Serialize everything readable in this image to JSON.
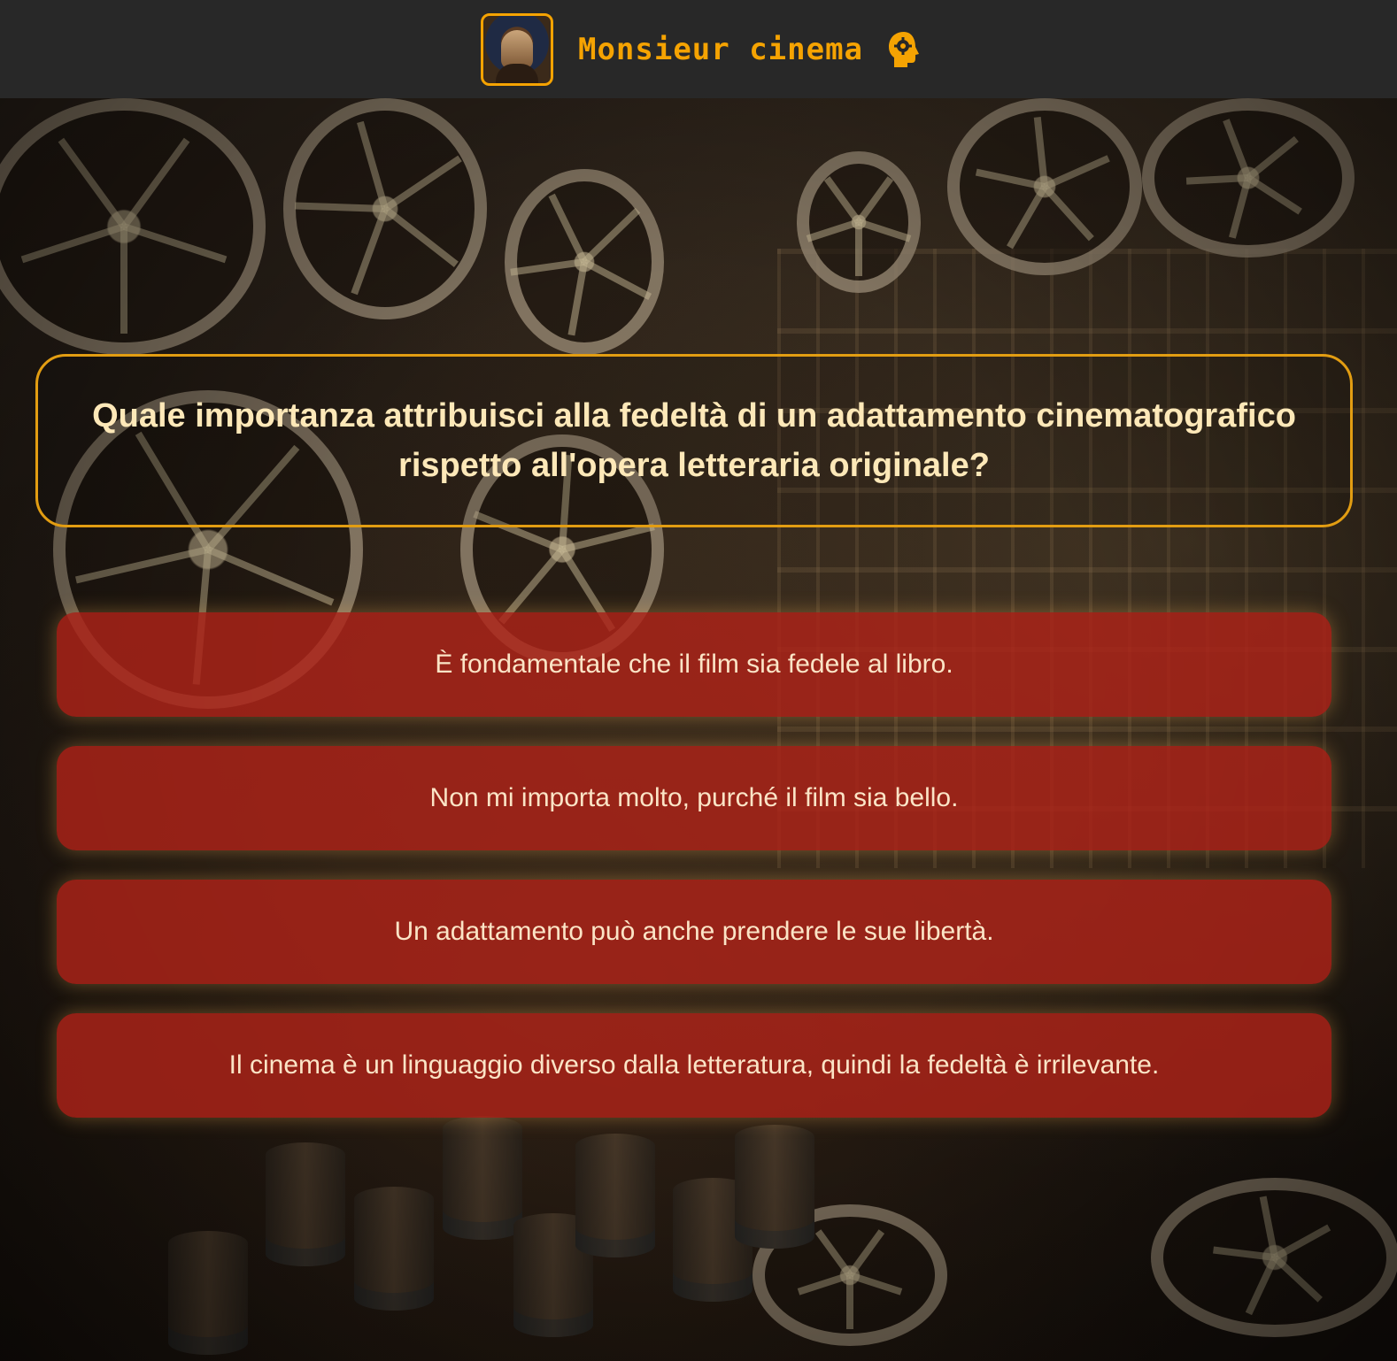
{
  "header": {
    "brand": "Monsieur cinema",
    "logo_icon": "monsieur-cinema-logo",
    "head_icon": "head-gear-icon",
    "accent_color": "#f5a302",
    "background_color": "#282828"
  },
  "question": {
    "text": "Quale importanza attribuisci alla fedeltà di un adattamento cinematografico rispetto all'opera letteraria originale?",
    "border_color": "#e29d12",
    "text_color": "#fde8b8"
  },
  "answers": [
    {
      "label": "È fondamentale che il film sia fedele al libro."
    },
    {
      "label": "Non mi importa molto, purché il film sia bello."
    },
    {
      "label": "Un adattamento può anche prendere le sue libertà."
    },
    {
      "label": "Il cinema è un linguaggio diverso dalla letteratura, quindi la fedeltà è irrilevante."
    }
  ],
  "answer_style": {
    "background_color": "#af2319",
    "text_color": "#fbe4c6"
  },
  "background": {
    "image": "film-reels-archive-background"
  }
}
